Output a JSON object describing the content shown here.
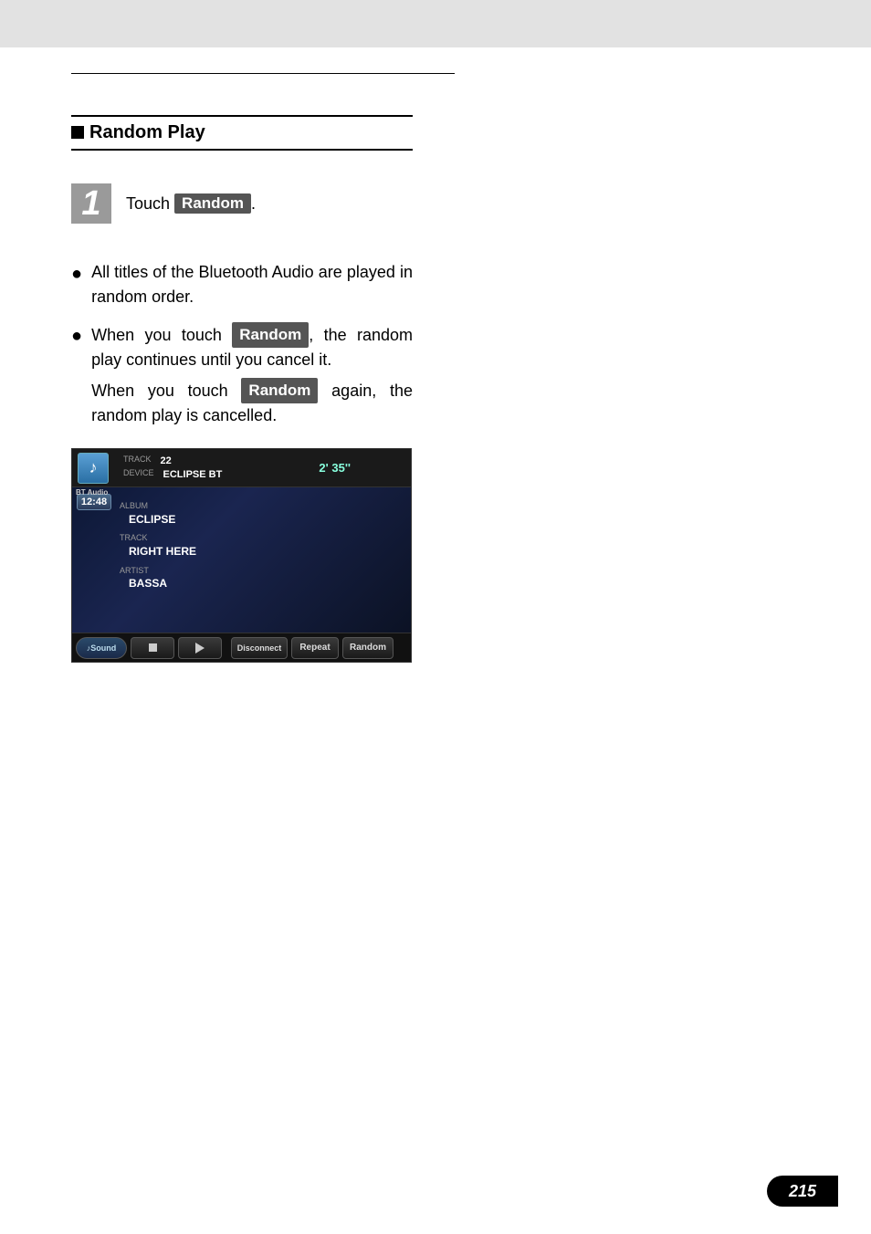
{
  "page_number": "215",
  "section": {
    "title": "Random Play"
  },
  "step": {
    "number": "1",
    "prefix": "Touch ",
    "button": "Random",
    "suffix": "."
  },
  "bullets": [
    {
      "text": "All titles of the Bluetooth Audio are played in random order."
    }
  ],
  "bullet2": {
    "pre": "When you touch ",
    "btn1": "Random",
    "mid": ", the random play continues until you cancel it.",
    "sub_pre": "When you touch ",
    "btn2": "Random",
    "sub_post": " again, the random play is cancelled."
  },
  "screenshot": {
    "bt_label": "BT Audio",
    "track_label": "TRACK",
    "track_value": "22",
    "device_label": "DEVICE",
    "device_value": "ECLIPSE BT",
    "elapsed": "2' 35''",
    "clock": "12:48",
    "album_label": "ALBUM",
    "album_value": "ECLIPSE",
    "trackname_label": "TRACK",
    "trackname_value": "RIGHT HERE",
    "artist_label": "ARTIST",
    "artist_value": "BASSA",
    "btn_sound": "♪Sound",
    "btn_disconnect": "Disconnect",
    "btn_repeat": "Repeat",
    "btn_random": "Random"
  }
}
